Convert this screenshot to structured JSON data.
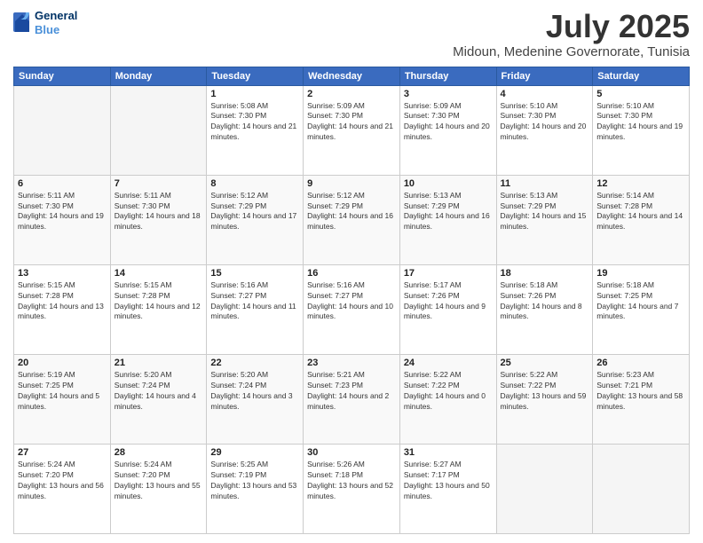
{
  "header": {
    "logo_line1": "General",
    "logo_line2": "Blue",
    "main_title": "July 2025",
    "sub_title": "Midoun, Medenine Governorate, Tunisia"
  },
  "weekdays": [
    "Sunday",
    "Monday",
    "Tuesday",
    "Wednesday",
    "Thursday",
    "Friday",
    "Saturday"
  ],
  "weeks": [
    [
      {
        "day": "",
        "info": ""
      },
      {
        "day": "",
        "info": ""
      },
      {
        "day": "1",
        "info": "Sunrise: 5:08 AM\nSunset: 7:30 PM\nDaylight: 14 hours and 21 minutes."
      },
      {
        "day": "2",
        "info": "Sunrise: 5:09 AM\nSunset: 7:30 PM\nDaylight: 14 hours and 21 minutes."
      },
      {
        "day": "3",
        "info": "Sunrise: 5:09 AM\nSunset: 7:30 PM\nDaylight: 14 hours and 20 minutes."
      },
      {
        "day": "4",
        "info": "Sunrise: 5:10 AM\nSunset: 7:30 PM\nDaylight: 14 hours and 20 minutes."
      },
      {
        "day": "5",
        "info": "Sunrise: 5:10 AM\nSunset: 7:30 PM\nDaylight: 14 hours and 19 minutes."
      }
    ],
    [
      {
        "day": "6",
        "info": "Sunrise: 5:11 AM\nSunset: 7:30 PM\nDaylight: 14 hours and 19 minutes."
      },
      {
        "day": "7",
        "info": "Sunrise: 5:11 AM\nSunset: 7:30 PM\nDaylight: 14 hours and 18 minutes."
      },
      {
        "day": "8",
        "info": "Sunrise: 5:12 AM\nSunset: 7:29 PM\nDaylight: 14 hours and 17 minutes."
      },
      {
        "day": "9",
        "info": "Sunrise: 5:12 AM\nSunset: 7:29 PM\nDaylight: 14 hours and 16 minutes."
      },
      {
        "day": "10",
        "info": "Sunrise: 5:13 AM\nSunset: 7:29 PM\nDaylight: 14 hours and 16 minutes."
      },
      {
        "day": "11",
        "info": "Sunrise: 5:13 AM\nSunset: 7:29 PM\nDaylight: 14 hours and 15 minutes."
      },
      {
        "day": "12",
        "info": "Sunrise: 5:14 AM\nSunset: 7:28 PM\nDaylight: 14 hours and 14 minutes."
      }
    ],
    [
      {
        "day": "13",
        "info": "Sunrise: 5:15 AM\nSunset: 7:28 PM\nDaylight: 14 hours and 13 minutes."
      },
      {
        "day": "14",
        "info": "Sunrise: 5:15 AM\nSunset: 7:28 PM\nDaylight: 14 hours and 12 minutes."
      },
      {
        "day": "15",
        "info": "Sunrise: 5:16 AM\nSunset: 7:27 PM\nDaylight: 14 hours and 11 minutes."
      },
      {
        "day": "16",
        "info": "Sunrise: 5:16 AM\nSunset: 7:27 PM\nDaylight: 14 hours and 10 minutes."
      },
      {
        "day": "17",
        "info": "Sunrise: 5:17 AM\nSunset: 7:26 PM\nDaylight: 14 hours and 9 minutes."
      },
      {
        "day": "18",
        "info": "Sunrise: 5:18 AM\nSunset: 7:26 PM\nDaylight: 14 hours and 8 minutes."
      },
      {
        "day": "19",
        "info": "Sunrise: 5:18 AM\nSunset: 7:25 PM\nDaylight: 14 hours and 7 minutes."
      }
    ],
    [
      {
        "day": "20",
        "info": "Sunrise: 5:19 AM\nSunset: 7:25 PM\nDaylight: 14 hours and 5 minutes."
      },
      {
        "day": "21",
        "info": "Sunrise: 5:20 AM\nSunset: 7:24 PM\nDaylight: 14 hours and 4 minutes."
      },
      {
        "day": "22",
        "info": "Sunrise: 5:20 AM\nSunset: 7:24 PM\nDaylight: 14 hours and 3 minutes."
      },
      {
        "day": "23",
        "info": "Sunrise: 5:21 AM\nSunset: 7:23 PM\nDaylight: 14 hours and 2 minutes."
      },
      {
        "day": "24",
        "info": "Sunrise: 5:22 AM\nSunset: 7:22 PM\nDaylight: 14 hours and 0 minutes."
      },
      {
        "day": "25",
        "info": "Sunrise: 5:22 AM\nSunset: 7:22 PM\nDaylight: 13 hours and 59 minutes."
      },
      {
        "day": "26",
        "info": "Sunrise: 5:23 AM\nSunset: 7:21 PM\nDaylight: 13 hours and 58 minutes."
      }
    ],
    [
      {
        "day": "27",
        "info": "Sunrise: 5:24 AM\nSunset: 7:20 PM\nDaylight: 13 hours and 56 minutes."
      },
      {
        "day": "28",
        "info": "Sunrise: 5:24 AM\nSunset: 7:20 PM\nDaylight: 13 hours and 55 minutes."
      },
      {
        "day": "29",
        "info": "Sunrise: 5:25 AM\nSunset: 7:19 PM\nDaylight: 13 hours and 53 minutes."
      },
      {
        "day": "30",
        "info": "Sunrise: 5:26 AM\nSunset: 7:18 PM\nDaylight: 13 hours and 52 minutes."
      },
      {
        "day": "31",
        "info": "Sunrise: 5:27 AM\nSunset: 7:17 PM\nDaylight: 13 hours and 50 minutes."
      },
      {
        "day": "",
        "info": ""
      },
      {
        "day": "",
        "info": ""
      }
    ]
  ]
}
